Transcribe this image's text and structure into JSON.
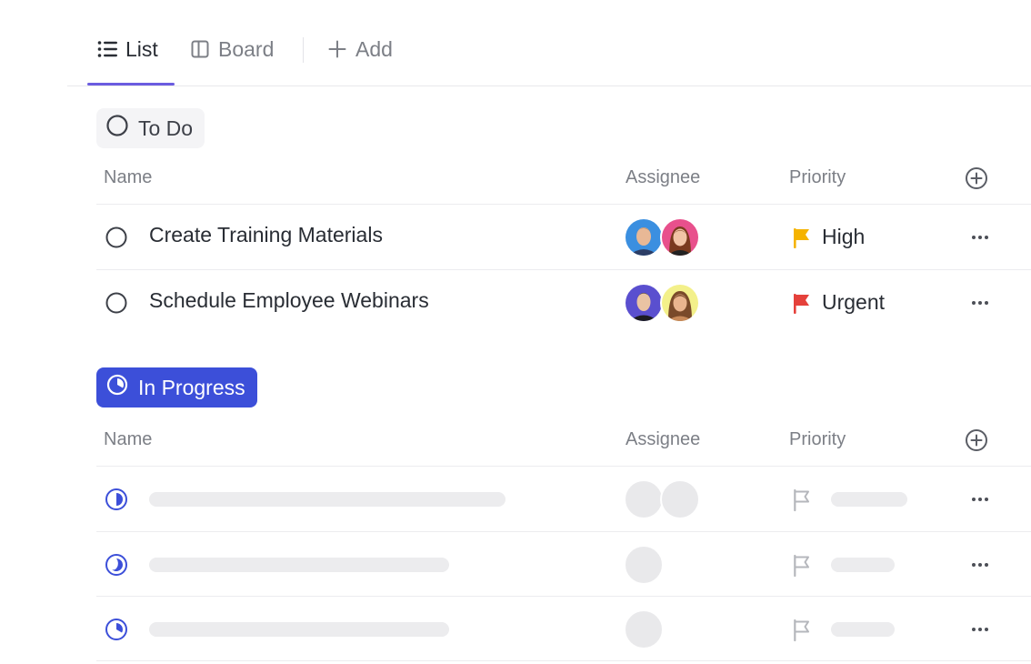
{
  "tabs": {
    "list": "List",
    "board": "Board",
    "add": "Add"
  },
  "groups": [
    {
      "status": "To Do",
      "columns": {
        "name": "Name",
        "assignee": "Assignee",
        "priority": "Priority"
      },
      "tasks": [
        {
          "name": "Create Training Materials",
          "priority": "High",
          "priority_color": "#f5b300"
        },
        {
          "name": "Schedule Employee Webinars",
          "priority": "Urgent",
          "priority_color": "#e5413b"
        }
      ]
    },
    {
      "status": "In Progress",
      "status_color": "#3c4fd9",
      "columns": {
        "name": "Name",
        "assignee": "Assignee",
        "priority": "Priority"
      },
      "placeholder_rows": 3
    }
  ],
  "colors": {
    "accent": "#6b5ce0",
    "in_progress": "#3c4fd9",
    "high": "#f5b300",
    "urgent": "#e5413b"
  }
}
